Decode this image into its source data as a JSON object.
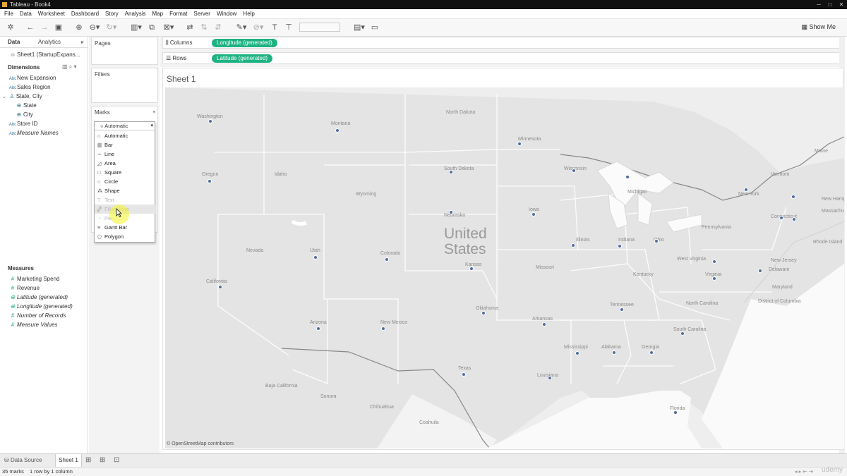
{
  "window": {
    "title": "Tableau - Book4"
  },
  "menu": [
    "File",
    "Data",
    "Worksheet",
    "Dashboard",
    "Story",
    "Analysis",
    "Map",
    "Format",
    "Server",
    "Window",
    "Help"
  ],
  "toolbar": {
    "show_me": "Show Me"
  },
  "data_pane": {
    "tabs": [
      "Data",
      "Analytics"
    ],
    "source": "Sheet1 (StartupExpans...",
    "dimensions_header": "Dimensions",
    "dimensions": [
      {
        "icon": "Abc",
        "label": "New Expansion"
      },
      {
        "icon": "Abc",
        "label": "Sales Region"
      },
      {
        "icon": "hier",
        "label": "State, City"
      },
      {
        "icon": "geo",
        "label": "State"
      },
      {
        "icon": "geo",
        "label": "City"
      },
      {
        "icon": "Abc",
        "label": "Store ID"
      },
      {
        "icon": "Abc",
        "label": "Measure Names"
      }
    ],
    "measures_header": "Measures",
    "measures": [
      {
        "icon": "#",
        "label": "Marketing Spend"
      },
      {
        "icon": "#",
        "label": "Revenue"
      },
      {
        "icon": "geo",
        "label": "Latitude (generated)"
      },
      {
        "icon": "geo",
        "label": "Longitude (generated)"
      },
      {
        "icon": "#",
        "label": "Number of Records"
      },
      {
        "icon": "#",
        "label": "Measure Values"
      }
    ]
  },
  "cards": {
    "pages": "Pages",
    "filters": "Filters",
    "marks": "Marks"
  },
  "marks_dropdown": {
    "selected": "Automatic",
    "items": [
      "Automatic",
      "Bar",
      "Line",
      "Area",
      "Square",
      "Circle",
      "Shape",
      "Text",
      "Filled Map",
      "Pie",
      "Gantt Bar",
      "Polygon"
    ]
  },
  "shelves": {
    "columns_label": "Columns",
    "columns_pill": "Longitude (generated)",
    "rows_label": "Rows",
    "rows_pill": "Latitude (generated)"
  },
  "sheet": {
    "title": "Sheet 1"
  },
  "map": {
    "country_label_1": "United",
    "country_label_2": "States",
    "attribution": "© OpenStreetMap contributors",
    "labels": [
      "Washington",
      "Oregon",
      "California",
      "Nevada",
      "Idaho",
      "Montana",
      "Wyoming",
      "Utah",
      "Colorado",
      "Arizona",
      "New Mexico",
      "North Dakota",
      "South Dakota",
      "Nebraska",
      "Kansas",
      "Oklahoma",
      "Texas",
      "Minnesota",
      "Iowa",
      "Missouri",
      "Arkansas",
      "Louisiana",
      "Wisconsin",
      "Illinois",
      "Michigan",
      "Indiana",
      "Ohio",
      "Kentucky",
      "Tennessee",
      "Mississippi",
      "Alabama",
      "Georgia",
      "Florida",
      "South Carolina",
      "North Carolina",
      "Virginia",
      "West Virginia",
      "Pennsylvania",
      "New York",
      "Vermont",
      "Maine",
      "Connecticut",
      "New Jersey",
      "Delaware",
      "Maryland",
      "District of Columbia",
      "Rhode Island",
      "New Hampshire",
      "Massachusetts",
      "Baja California",
      "Sonora",
      "Chihuahua",
      "Coahuila"
    ]
  },
  "bottom": {
    "data_source": "Data Source",
    "sheet_tab": "Sheet 1"
  },
  "status": {
    "marks": "35 marks",
    "dims": "1 row by 1 column"
  },
  "colors": {
    "pill": "#1eb283",
    "mark": "#4e6e9e",
    "accent": "#e8a53a"
  }
}
